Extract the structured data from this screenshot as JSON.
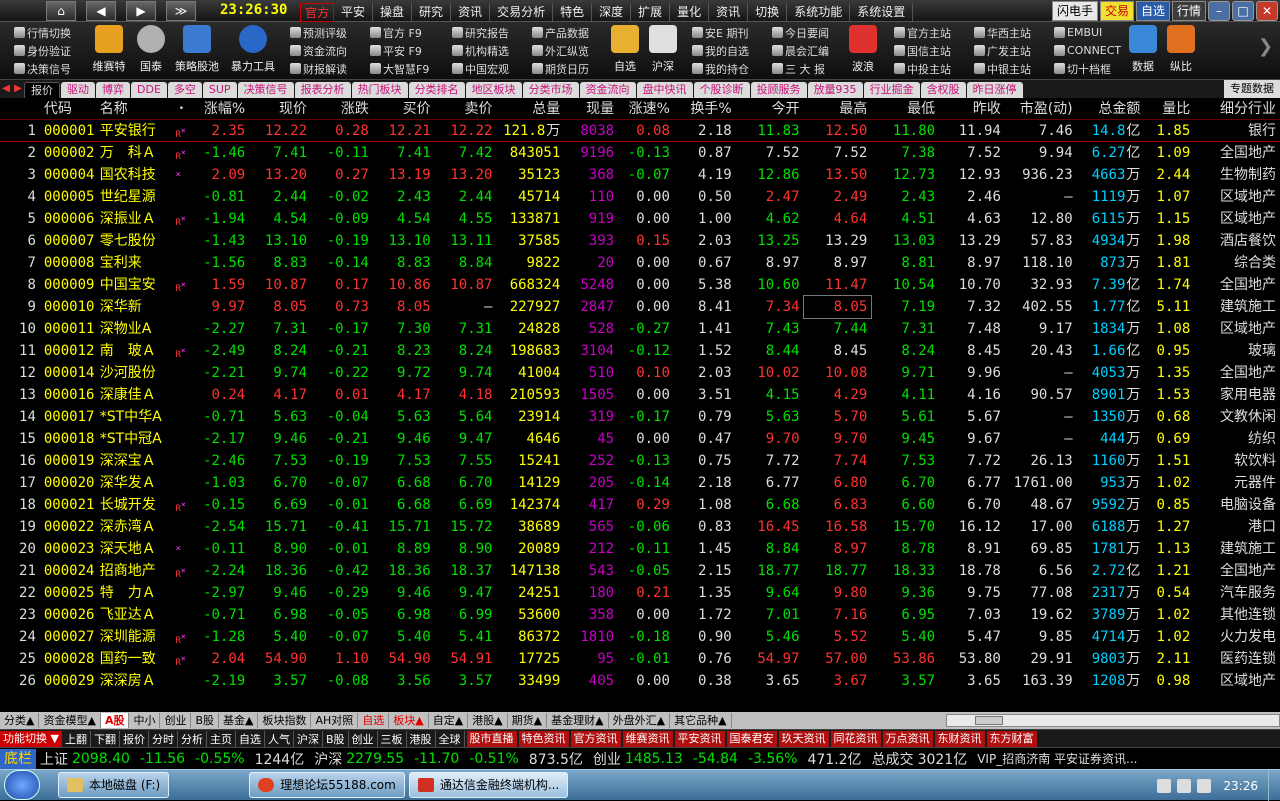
{
  "menubar": {
    "nav_buttons": [
      "⌂",
      "◀",
      "▶",
      "≫"
    ],
    "clock": "23:26:30",
    "menus": [
      "官方",
      "平安",
      "操盘",
      "研究",
      "资讯",
      "交易分析",
      "特色",
      "深度",
      "扩展",
      "量化",
      "资讯",
      "切换",
      "系统功能",
      "系统设置"
    ],
    "right_buttons": [
      "闪电手",
      "交易",
      "自选",
      "行情"
    ],
    "window_buttons": [
      "–",
      "□",
      "✕"
    ]
  },
  "toolbar": {
    "left_small": [
      "行情切换",
      "身份验证",
      "决策信号"
    ],
    "big_icons": [
      {
        "label": "维赛特",
        "icon": "chart-check-icon",
        "color": "#e8a020"
      },
      {
        "label": "国泰",
        "icon": "safe-icon",
        "color": "#b0b0b0"
      },
      {
        "label": "策略股池",
        "icon": "stock-pool-icon",
        "color": "#3a7ad0"
      },
      {
        "label": "暴力工具",
        "icon": "magnifier-icon",
        "color": "#2a68c8"
      }
    ],
    "col1": [
      "预测评级",
      "资金流向",
      "财报解读"
    ],
    "col2": [
      "官方 F9",
      "平安 F9",
      "大智慧F9"
    ],
    "col3": [
      "研究报告",
      "机构精选",
      "中国宏观"
    ],
    "col4": [
      "产品数据",
      "外汇纵览",
      "期货日历"
    ],
    "mid_big": [
      {
        "label": "自选",
        "icon": "yen-icon",
        "color": "#e8b030"
      },
      {
        "label": "沪深",
        "icon": "calendar-icon",
        "color": "#e0e0e0"
      }
    ],
    "col5": [
      "安E 期刊",
      "我的自选",
      "我的持仓"
    ],
    "col6": [
      "今日要闻",
      "晨会汇编",
      "三 大 报"
    ],
    "mid_big2": [
      {
        "label": "波浪",
        "icon": "wave-icon",
        "color": "#e03030"
      }
    ],
    "col7": [
      "官方主站",
      "国信主站",
      "中投主站"
    ],
    "col8": [
      "华西主站",
      "广发主站",
      "中银主站"
    ],
    "col9": [
      "EMBUI",
      "CONNECT",
      "切十档框"
    ],
    "right_big": [
      {
        "label": "数据",
        "icon": "data-icon",
        "color": "#3a88d8"
      },
      {
        "label": "纵比",
        "icon": "compare-icon",
        "color": "#e07020"
      }
    ]
  },
  "tabs": [
    "报价",
    "驱动",
    "博弈",
    "DDE",
    "多空",
    "SUP",
    "决策信号",
    "报表分析",
    "热门板块",
    "分类排名",
    "地区板块",
    "分类市场",
    "资金流向",
    "盘中快讯",
    "个股诊断",
    "投顾服务",
    "放量935",
    "行业掘金",
    "含权股",
    "昨日涨停"
  ],
  "tabs_right": "专题数据",
  "columns": [
    "",
    "代码",
    "名称",
    "•",
    "涨幅%",
    "现价",
    "涨跌",
    "买价",
    "卖价",
    "总量",
    "现量",
    "涨速%",
    "换手%",
    "今开",
    "最高",
    "最低",
    "昨收",
    "市盈(动)",
    "总金额",
    "量比",
    "细分行业"
  ],
  "rows": [
    {
      "n": "1",
      "code": "000001",
      "name": "平安银行",
      "mark": "R",
      "chg": "2.35",
      "price": "12.22",
      "diff": "0.28",
      "bid": "12.21",
      "ask": "12.22",
      "vol": "121.8",
      "volu": "万",
      "cur": "8038",
      "spd": "0.08",
      "turn": "2.18",
      "open": "11.83",
      "high": "12.50",
      "low": "11.80",
      "prev": "11.94",
      "pe": "7.46",
      "amt": "14.8",
      "amtu": "亿",
      "vr": "1.85",
      "ind": "银行"
    },
    {
      "n": "2",
      "code": "000002",
      "name": "万　科Ａ",
      "mark": "R",
      "chg": "-1.46",
      "price": "7.41",
      "diff": "-0.11",
      "bid": "7.41",
      "ask": "7.42",
      "vol": "843051",
      "volu": "",
      "cur": "9196",
      "spd": "-0.13",
      "turn": "0.87",
      "open": "7.52",
      "high": "7.52",
      "low": "7.38",
      "prev": "7.52",
      "pe": "9.94",
      "amt": "6.27",
      "amtu": "亿",
      "vr": "1.09",
      "ind": "全国地产"
    },
    {
      "n": "3",
      "code": "000004",
      "name": "国农科技",
      "mark": "×",
      "chg": "2.09",
      "price": "13.20",
      "diff": "0.27",
      "bid": "13.19",
      "ask": "13.20",
      "vol": "35123",
      "volu": "",
      "cur": "368",
      "spd": "-0.07",
      "turn": "4.19",
      "open": "12.86",
      "high": "13.50",
      "low": "12.73",
      "prev": "12.93",
      "pe": "936.23",
      "amt": "4663",
      "amtu": "万",
      "vr": "2.44",
      "ind": "生物制药"
    },
    {
      "n": "4",
      "code": "000005",
      "name": "世纪星源",
      "mark": "",
      "chg": "-0.81",
      "price": "2.44",
      "diff": "-0.02",
      "bid": "2.43",
      "ask": "2.44",
      "vol": "45714",
      "volu": "",
      "cur": "110",
      "spd": "0.00",
      "turn": "0.50",
      "open": "2.47",
      "high": "2.49",
      "low": "2.43",
      "prev": "2.46",
      "pe": "—",
      "amt": "1119",
      "amtu": "万",
      "vr": "1.07",
      "ind": "区域地产"
    },
    {
      "n": "5",
      "code": "000006",
      "name": "深振业Ａ",
      "mark": "R",
      "chg": "-1.94",
      "price": "4.54",
      "diff": "-0.09",
      "bid": "4.54",
      "ask": "4.55",
      "vol": "133871",
      "volu": "",
      "cur": "919",
      "spd": "0.00",
      "turn": "1.00",
      "open": "4.62",
      "high": "4.64",
      "low": "4.51",
      "prev": "4.63",
      "pe": "12.80",
      "amt": "6115",
      "amtu": "万",
      "vr": "1.15",
      "ind": "区域地产"
    },
    {
      "n": "6",
      "code": "000007",
      "name": "零七股份",
      "mark": "",
      "chg": "-1.43",
      "price": "13.10",
      "diff": "-0.19",
      "bid": "13.10",
      "ask": "13.11",
      "vol": "37585",
      "volu": "",
      "cur": "393",
      "spd": "0.15",
      "turn": "2.03",
      "open": "13.25",
      "high": "13.29",
      "low": "13.03",
      "prev": "13.29",
      "pe": "57.83",
      "amt": "4934",
      "amtu": "万",
      "vr": "1.98",
      "ind": "酒店餐饮"
    },
    {
      "n": "7",
      "code": "000008",
      "name": "宝利来",
      "mark": "",
      "chg": "-1.56",
      "price": "8.83",
      "diff": "-0.14",
      "bid": "8.83",
      "ask": "8.84",
      "vol": "9822",
      "volu": "",
      "cur": "20",
      "spd": "0.00",
      "turn": "0.67",
      "open": "8.97",
      "high": "8.97",
      "low": "8.81",
      "prev": "8.97",
      "pe": "118.10",
      "amt": "873",
      "amtu": "万",
      "vr": "1.81",
      "ind": "综合类"
    },
    {
      "n": "8",
      "code": "000009",
      "name": "中国宝安",
      "mark": "R",
      "chg": "1.59",
      "price": "10.87",
      "diff": "0.17",
      "bid": "10.86",
      "ask": "10.87",
      "vol": "668324",
      "volu": "",
      "cur": "5248",
      "spd": "0.00",
      "turn": "5.38",
      "open": "10.60",
      "high": "11.47",
      "low": "10.54",
      "prev": "10.70",
      "pe": "32.93",
      "amt": "7.39",
      "amtu": "亿",
      "vr": "1.74",
      "ind": "全国地产"
    },
    {
      "n": "9",
      "code": "000010",
      "name": "深华新",
      "mark": "",
      "chg": "9.97",
      "price": "8.05",
      "diff": "0.73",
      "bid": "8.05",
      "ask": "—",
      "vol": "227927",
      "volu": "",
      "cur": "2847",
      "spd": "0.00",
      "turn": "8.41",
      "open": "7.34",
      "high": "8.05",
      "low": "7.19",
      "prev": "7.32",
      "pe": "402.55",
      "amt": "1.77",
      "amtu": "亿",
      "vr": "5.11",
      "ind": "建筑施工"
    },
    {
      "n": "10",
      "code": "000011",
      "name": "深物业A",
      "mark": "",
      "chg": "-2.27",
      "price": "7.31",
      "diff": "-0.17",
      "bid": "7.30",
      "ask": "7.31",
      "vol": "24828",
      "volu": "",
      "cur": "528",
      "spd": "-0.27",
      "turn": "1.41",
      "open": "7.43",
      "high": "7.44",
      "low": "7.31",
      "prev": "7.48",
      "pe": "9.17",
      "amt": "1834",
      "amtu": "万",
      "vr": "1.08",
      "ind": "区域地产"
    },
    {
      "n": "11",
      "code": "000012",
      "name": "南　玻Ａ",
      "mark": "R",
      "chg": "-2.49",
      "price": "8.24",
      "diff": "-0.21",
      "bid": "8.23",
      "ask": "8.24",
      "vol": "198683",
      "volu": "",
      "cur": "3104",
      "spd": "-0.12",
      "turn": "1.52",
      "open": "8.44",
      "high": "8.45",
      "low": "8.24",
      "prev": "8.45",
      "pe": "20.43",
      "amt": "1.66",
      "amtu": "亿",
      "vr": "0.95",
      "ind": "玻璃"
    },
    {
      "n": "12",
      "code": "000014",
      "name": "沙河股份",
      "mark": "",
      "chg": "-2.21",
      "price": "9.74",
      "diff": "-0.22",
      "bid": "9.72",
      "ask": "9.74",
      "vol": "41004",
      "volu": "",
      "cur": "510",
      "spd": "0.10",
      "turn": "2.03",
      "open": "10.02",
      "high": "10.08",
      "low": "9.71",
      "prev": "9.96",
      "pe": "—",
      "amt": "4053",
      "amtu": "万",
      "vr": "1.35",
      "ind": "全国地产"
    },
    {
      "n": "13",
      "code": "000016",
      "name": "深康佳Ａ",
      "mark": "",
      "chg": "0.24",
      "price": "4.17",
      "diff": "0.01",
      "bid": "4.17",
      "ask": "4.18",
      "vol": "210593",
      "volu": "",
      "cur": "1505",
      "spd": "0.00",
      "turn": "3.51",
      "open": "4.15",
      "high": "4.29",
      "low": "4.11",
      "prev": "4.16",
      "pe": "90.57",
      "amt": "8901",
      "amtu": "万",
      "vr": "1.53",
      "ind": "家用电器"
    },
    {
      "n": "14",
      "code": "000017",
      "name": "*ST中华A",
      "mark": "",
      "chg": "-0.71",
      "price": "5.63",
      "diff": "-0.04",
      "bid": "5.63",
      "ask": "5.64",
      "vol": "23914",
      "volu": "",
      "cur": "319",
      "spd": "-0.17",
      "turn": "0.79",
      "open": "5.63",
      "high": "5.70",
      "low": "5.61",
      "prev": "5.67",
      "pe": "—",
      "amt": "1350",
      "amtu": "万",
      "vr": "0.68",
      "ind": "文教休闲"
    },
    {
      "n": "15",
      "code": "000018",
      "name": "*ST中冠A",
      "mark": "",
      "chg": "-2.17",
      "price": "9.46",
      "diff": "-0.21",
      "bid": "9.46",
      "ask": "9.47",
      "vol": "4646",
      "volu": "",
      "cur": "45",
      "spd": "0.00",
      "turn": "0.47",
      "open": "9.70",
      "high": "9.70",
      "low": "9.45",
      "prev": "9.67",
      "pe": "—",
      "amt": "444",
      "amtu": "万",
      "vr": "0.69",
      "ind": "纺织"
    },
    {
      "n": "16",
      "code": "000019",
      "name": "深深宝Ａ",
      "mark": "",
      "chg": "-2.46",
      "price": "7.53",
      "diff": "-0.19",
      "bid": "7.53",
      "ask": "7.55",
      "vol": "15241",
      "volu": "",
      "cur": "252",
      "spd": "-0.13",
      "turn": "0.75",
      "open": "7.72",
      "high": "7.74",
      "low": "7.53",
      "prev": "7.72",
      "pe": "26.13",
      "amt": "1160",
      "amtu": "万",
      "vr": "1.51",
      "ind": "软饮料"
    },
    {
      "n": "17",
      "code": "000020",
      "name": "深华发Ａ",
      "mark": "",
      "chg": "-1.03",
      "price": "6.70",
      "diff": "-0.07",
      "bid": "6.68",
      "ask": "6.70",
      "vol": "14129",
      "volu": "",
      "cur": "205",
      "spd": "-0.14",
      "turn": "2.18",
      "open": "6.77",
      "high": "6.80",
      "low": "6.70",
      "prev": "6.77",
      "pe": "1761.00",
      "amt": "953",
      "amtu": "万",
      "vr": "1.02",
      "ind": "元器件"
    },
    {
      "n": "18",
      "code": "000021",
      "name": "长城开发",
      "mark": "R",
      "chg": "-0.15",
      "price": "6.69",
      "diff": "-0.01",
      "bid": "6.68",
      "ask": "6.69",
      "vol": "142374",
      "volu": "",
      "cur": "417",
      "spd": "0.29",
      "turn": "1.08",
      "open": "6.68",
      "high": "6.83",
      "low": "6.60",
      "prev": "6.70",
      "pe": "48.67",
      "amt": "9592",
      "amtu": "万",
      "vr": "0.85",
      "ind": "电脑设备"
    },
    {
      "n": "19",
      "code": "000022",
      "name": "深赤湾Ａ",
      "mark": "",
      "chg": "-2.54",
      "price": "15.71",
      "diff": "-0.41",
      "bid": "15.71",
      "ask": "15.72",
      "vol": "38689",
      "volu": "",
      "cur": "565",
      "spd": "-0.06",
      "turn": "0.83",
      "open": "16.45",
      "high": "16.58",
      "low": "15.70",
      "prev": "16.12",
      "pe": "17.00",
      "amt": "6188",
      "amtu": "万",
      "vr": "1.27",
      "ind": "港口"
    },
    {
      "n": "20",
      "code": "000023",
      "name": "深天地Ａ",
      "mark": "×",
      "chg": "-0.11",
      "price": "8.90",
      "diff": "-0.01",
      "bid": "8.89",
      "ask": "8.90",
      "vol": "20089",
      "volu": "",
      "cur": "212",
      "spd": "-0.11",
      "turn": "1.45",
      "open": "8.84",
      "high": "8.97",
      "low": "8.78",
      "prev": "8.91",
      "pe": "69.85",
      "amt": "1781",
      "amtu": "万",
      "vr": "1.13",
      "ind": "建筑施工"
    },
    {
      "n": "21",
      "code": "000024",
      "name": "招商地产",
      "mark": "R",
      "chg": "-2.24",
      "price": "18.36",
      "diff": "-0.42",
      "bid": "18.36",
      "ask": "18.37",
      "vol": "147138",
      "volu": "",
      "cur": "543",
      "spd": "-0.05",
      "turn": "2.15",
      "open": "18.77",
      "high": "18.77",
      "low": "18.33",
      "prev": "18.78",
      "pe": "6.56",
      "amt": "2.72",
      "amtu": "亿",
      "vr": "1.21",
      "ind": "全国地产"
    },
    {
      "n": "22",
      "code": "000025",
      "name": "特　力Ａ",
      "mark": "",
      "chg": "-2.97",
      "price": "9.46",
      "diff": "-0.29",
      "bid": "9.46",
      "ask": "9.47",
      "vol": "24251",
      "volu": "",
      "cur": "180",
      "spd": "0.21",
      "turn": "1.35",
      "open": "9.64",
      "high": "9.80",
      "low": "9.36",
      "prev": "9.75",
      "pe": "77.08",
      "amt": "2317",
      "amtu": "万",
      "vr": "0.54",
      "ind": "汽车服务"
    },
    {
      "n": "23",
      "code": "000026",
      "name": "飞亚达Ａ",
      "mark": "",
      "chg": "-0.71",
      "price": "6.98",
      "diff": "-0.05",
      "bid": "6.98",
      "ask": "6.99",
      "vol": "53600",
      "volu": "",
      "cur": "358",
      "spd": "0.00",
      "turn": "1.72",
      "open": "7.01",
      "high": "7.16",
      "low": "6.95",
      "prev": "7.03",
      "pe": "19.62",
      "amt": "3789",
      "amtu": "万",
      "vr": "1.02",
      "ind": "其他连锁"
    },
    {
      "n": "24",
      "code": "000027",
      "name": "深圳能源",
      "mark": "R",
      "chg": "-1.28",
      "price": "5.40",
      "diff": "-0.07",
      "bid": "5.40",
      "ask": "5.41",
      "vol": "86372",
      "volu": "",
      "cur": "1810",
      "spd": "-0.18",
      "turn": "0.90",
      "open": "5.46",
      "high": "5.52",
      "low": "5.40",
      "prev": "5.47",
      "pe": "9.85",
      "amt": "4714",
      "amtu": "万",
      "vr": "1.02",
      "ind": "火力发电"
    },
    {
      "n": "25",
      "code": "000028",
      "name": "国药一致",
      "mark": "R",
      "chg": "2.04",
      "price": "54.90",
      "diff": "1.10",
      "bid": "54.90",
      "ask": "54.91",
      "vol": "17725",
      "volu": "",
      "cur": "95",
      "spd": "-0.01",
      "turn": "0.76",
      "open": "54.97",
      "high": "57.00",
      "low": "53.86",
      "prev": "53.80",
      "pe": "29.91",
      "amt": "9803",
      "amtu": "万",
      "vr": "2.11",
      "ind": "医药连锁"
    },
    {
      "n": "26",
      "code": "000029",
      "name": "深深房Ａ",
      "mark": "",
      "chg": "-2.19",
      "price": "3.57",
      "diff": "-0.08",
      "bid": "3.56",
      "ask": "3.57",
      "vol": "33499",
      "volu": "",
      "cur": "405",
      "spd": "0.00",
      "turn": "0.38",
      "open": "3.65",
      "high": "3.67",
      "low": "3.57",
      "prev": "3.65",
      "pe": "163.39",
      "amt": "1208",
      "amtu": "万",
      "vr": "0.98",
      "ind": "区域地产"
    }
  ],
  "bottom_tabs": [
    "分类▲",
    "资金模型▲",
    "A股",
    "中小",
    "创业",
    "B股",
    "基金▲",
    "板块指数",
    "AH对照",
    "自选",
    "板块▲",
    "自定▲",
    "港股▲",
    "期货▲",
    "基金理财▲",
    "外盘外汇▲",
    "其它品种▲"
  ],
  "func_bar": {
    "select": "功能切换",
    "items": [
      "上翻",
      "下翻",
      "报价",
      "分时",
      "分析",
      "主页",
      "自选",
      "人气",
      "沪深",
      "B股",
      "创业",
      "三板",
      "港股",
      "全球"
    ],
    "red_items": [
      "股市直播",
      "特色资讯",
      "官方资讯",
      "维赛资讯",
      "平安资讯",
      "国泰君安",
      "玖天资讯",
      "同花资讯",
      "万点资讯",
      "东财资讯",
      "东方财富"
    ]
  },
  "ticker": {
    "label": "底栏",
    "items": [
      {
        "name": "上证",
        "value": "2098.40",
        "chg": "-11.56",
        "pct": "-0.55%",
        "amt": "1244亿"
      },
      {
        "name": "沪深",
        "value": "2279.55",
        "chg": "-11.70",
        "pct": "-0.51%",
        "amt": "873.5亿"
      },
      {
        "name": "创业",
        "value": "1485.13",
        "chg": "-54.84",
        "pct": "-3.56%",
        "amt": "471.2亿"
      }
    ],
    "total_label": "总成交",
    "total": "3021亿",
    "news": "VIP_招商济南 平安证券资讯..."
  },
  "taskbar": {
    "tasks": [
      "本地磁盘 (F:)",
      "理想论坛55188.com",
      "通达信金融终端机构..."
    ],
    "time": "23:26"
  }
}
